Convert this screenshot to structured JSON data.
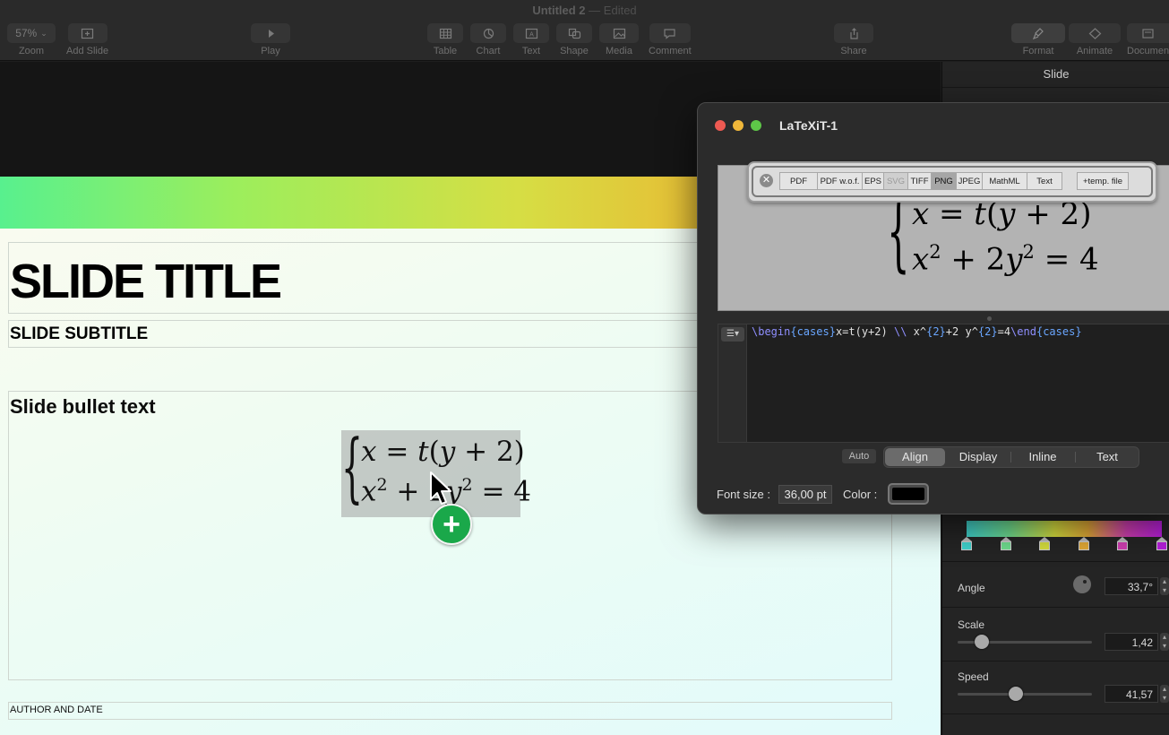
{
  "window": {
    "title": "Untitled 2",
    "separator": "—",
    "status": "Edited"
  },
  "toolbar": {
    "zoom_value": "57%",
    "items": [
      {
        "label": "Zoom"
      },
      {
        "label": "Add Slide"
      },
      {
        "label": "Play"
      },
      {
        "label": "Table"
      },
      {
        "label": "Chart"
      },
      {
        "label": "Text"
      },
      {
        "label": "Shape"
      },
      {
        "label": "Media"
      },
      {
        "label": "Comment"
      },
      {
        "label": "Share"
      },
      {
        "label": "Format"
      },
      {
        "label": "Animate"
      },
      {
        "label": "Document"
      }
    ]
  },
  "slide": {
    "title": "SLIDE TITLE",
    "subtitle": "SLIDE SUBTITLE",
    "bullet": "Slide bullet text",
    "author": "AUTHOR AND DATE",
    "equation": {
      "line1": [
        "x",
        " = ",
        "t",
        "(",
        "y",
        " + 2)"
      ],
      "line2": [
        "x",
        "2",
        " + 2",
        "y",
        "2",
        " = 4"
      ]
    }
  },
  "inspector": {
    "tab": "Slide",
    "angle_label": "Angle",
    "angle_value": "33,7°",
    "scale_label": "Scale",
    "scale_value": "1,42",
    "speed_label": "Speed",
    "speed_value": "41,57",
    "scale_fraction": 0.18,
    "speed_fraction": 0.43,
    "gradient_stops": [
      "#3fd1cc",
      "#6fdc8e",
      "#d4dc3e",
      "#e0a836",
      "#cf3fb0",
      "#b51ed9"
    ]
  },
  "latexit": {
    "title": "LaTeXiT-1",
    "export_formats": [
      "PDF",
      "PDF w.o.f.",
      "EPS",
      "SVG",
      "TIFF",
      "PNG",
      "JPEG",
      "MathML",
      "Text",
      "+temp. file"
    ],
    "selected_format": "PNG",
    "disabled_format": "SVG",
    "code": {
      "begin": "\\begin",
      "cases1": "{cases}",
      "body1": "x=t(y+2) ",
      "sep": "\\\\",
      "body2": " x^",
      "exp": "{2}",
      "body3": "+2 y^",
      "exp2": "{2}",
      "body4": "=4",
      "end": "\\end",
      "cases2": "{cases}"
    },
    "mode_auto": "Auto",
    "modes": [
      "Align",
      "Display",
      "Inline",
      "Text"
    ],
    "selected_mode": "Align",
    "font_size_label": "Font size :",
    "font_size_value": "36,00 pt",
    "color_label": "Color :",
    "color_value": "#000000"
  }
}
